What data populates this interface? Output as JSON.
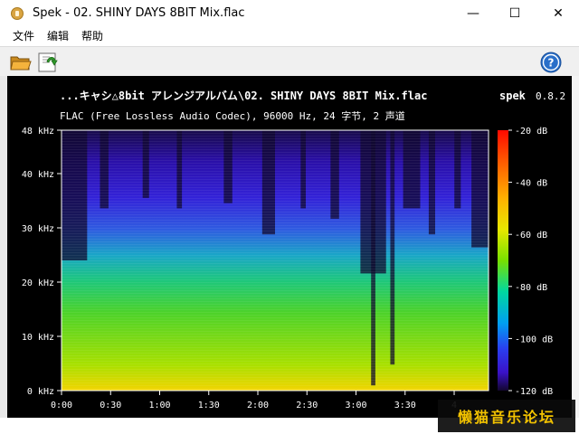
{
  "window": {
    "title": "Spek - 02. SHINY DAYS 8BIT Mix.flac",
    "min_glyph": "—",
    "max_glyph": "☐",
    "close_glyph": "✕"
  },
  "menu": {
    "items": [
      "文件",
      "编辑",
      "帮助"
    ]
  },
  "toolbar": {
    "icons": [
      "open-folder-icon",
      "save-icon",
      "help-icon"
    ]
  },
  "spectrogram": {
    "file_path": "...キャシ△8bit アレンジアルバム\\02. SHINY DAYS 8BIT Mix.flac",
    "app_name": "spek",
    "app_version": "0.8.2",
    "audio_info": "FLAC (Free Lossless Audio Codec), 96000 Hz, 24 字节, 2 声道",
    "freq_ticks": [
      "48 kHz",
      "40 kHz",
      "30 kHz",
      "20 kHz",
      "10 kHz",
      "0 kHz"
    ],
    "freq_values": [
      48,
      40,
      30,
      20,
      10,
      0
    ],
    "freq_max": 48,
    "time_ticks": [
      "0:00",
      "0:30",
      "1:00",
      "1:30",
      "2:00",
      "2:30",
      "3:00",
      "3:30",
      "4"
    ],
    "time_values": [
      0,
      30,
      60,
      90,
      120,
      150,
      180,
      210,
      240
    ],
    "time_max": 261,
    "db_ticks": [
      "-20 dB",
      "-40 dB",
      "-60 dB",
      "-80 dB",
      "-100 dB",
      "-120 dB"
    ],
    "db_values": [
      -20,
      -40,
      -60,
      -80,
      -100,
      -120
    ],
    "db_range": [
      -120,
      -20
    ]
  },
  "overlay": {
    "corner_watermark": "懒猫音乐论坛"
  },
  "colors": {
    "plot_bg": "#000000",
    "axis": "#ffffff",
    "watermark_text": "#f2c200"
  }
}
